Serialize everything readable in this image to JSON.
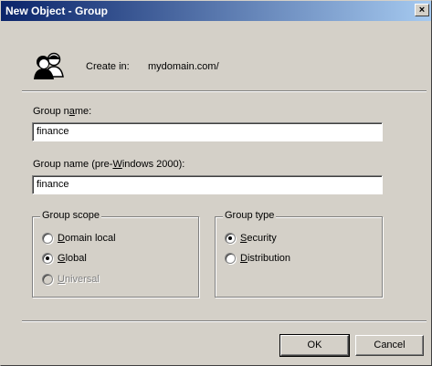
{
  "window": {
    "title": "New Object - Group",
    "close_glyph": "×"
  },
  "create_in": {
    "label": "Create in:",
    "value": "mydomain.com/",
    "icon": "group-users-icon"
  },
  "fields": {
    "group_name": {
      "label_pre": "Group n",
      "label_accel": "a",
      "label_post": "me:",
      "value": "finance"
    },
    "group_name_pre2000": {
      "label_pre": "Group name (pre-",
      "label_accel": "W",
      "label_post": "indows 2000):",
      "value": "finance"
    }
  },
  "group_scope": {
    "title": "Group scope",
    "options": [
      {
        "accel": "D",
        "rest": "omain local",
        "checked": false,
        "enabled": true
      },
      {
        "accel": "G",
        "rest": "lobal",
        "checked": true,
        "enabled": true
      },
      {
        "accel": "U",
        "rest": "niversal",
        "checked": false,
        "enabled": false
      }
    ]
  },
  "group_type": {
    "title": "Group type",
    "options": [
      {
        "accel": "S",
        "rest": "ecurity",
        "checked": true,
        "enabled": true
      },
      {
        "accel": "D",
        "rest": "istribution",
        "checked": false,
        "enabled": true
      }
    ]
  },
  "buttons": {
    "ok": "OK",
    "cancel": "Cancel"
  }
}
